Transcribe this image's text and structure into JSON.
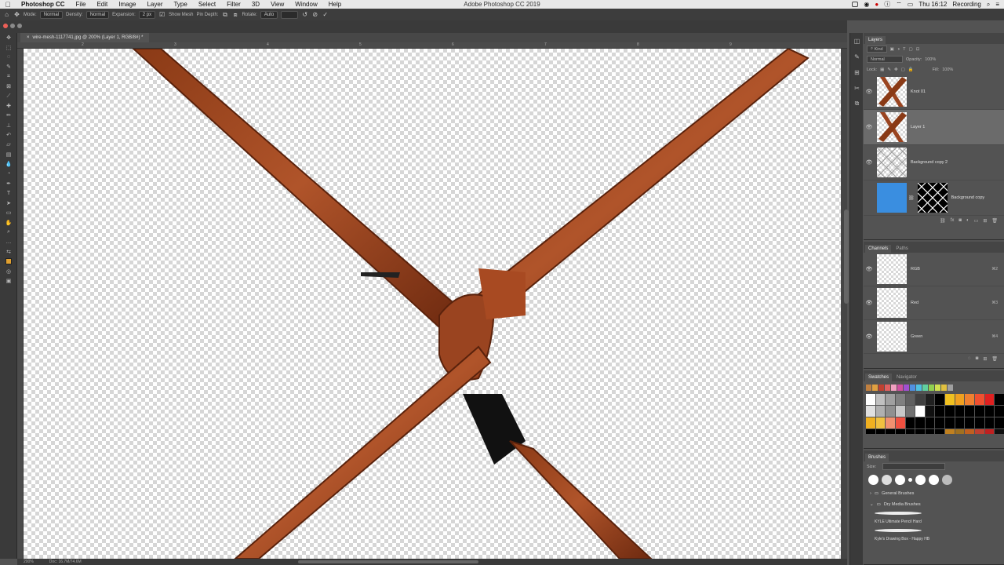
{
  "menubar": {
    "items": [
      "Photoshop CC",
      "File",
      "Edit",
      "Image",
      "Layer",
      "Type",
      "Select",
      "Filter",
      "3D",
      "View",
      "Window",
      "Help"
    ],
    "center_title": "Adobe Photoshop CC 2019",
    "clock": "Thu 16:12",
    "recording": "Recording"
  },
  "options": {
    "mode_label": "Mode:",
    "mode_value": "Normal",
    "density_label": "Density:",
    "density_value": "Normal",
    "expansion_label": "Expansion:",
    "expansion_value": "2 px",
    "show_mesh": "Show Mesh",
    "pin_depth": "Pin Depth:",
    "rotate_label": "Rotate:",
    "rotate_value": "Auto"
  },
  "document": {
    "tab_title": "wire-mesh-1117741.jpg @ 200% (Layer 1, RGB/8#) *"
  },
  "ruler": {
    "ticks": [
      "2",
      "3",
      "4",
      "5",
      "6",
      "7",
      "8",
      "9"
    ]
  },
  "status": {
    "zoom": "200%",
    "doc": "Doc: 16.7M/74.6M"
  },
  "layers_panel": {
    "tab": "Layers",
    "kind": "Kind",
    "blend": "Normal",
    "opacity_label": "Opacity:",
    "opacity": "100%",
    "lock_label": "Lock:",
    "fill_label": "Fill:",
    "fill": "100%",
    "layers": [
      {
        "name": "Knot 01"
      },
      {
        "name": "Layer 1"
      },
      {
        "name": "Background copy 2"
      },
      {
        "name": "Background copy"
      }
    ]
  },
  "channels_panel": {
    "tabs": [
      "Channels",
      "Paths"
    ],
    "channels": [
      {
        "name": "RGB",
        "shortcut": "⌘2"
      },
      {
        "name": "Red",
        "shortcut": "⌘3"
      },
      {
        "name": "Green",
        "shortcut": "⌘4"
      }
    ]
  },
  "swatches_panel": {
    "tabs": [
      "Swatches",
      "Navigator"
    ],
    "recent": [
      "#c08040",
      "#e0a040",
      "#c04030",
      "#e06060",
      "#f0a0c0",
      "#d050a0",
      "#a050d0",
      "#5090e0",
      "#50c0e0",
      "#60d0a0",
      "#90d050",
      "#d0e050",
      "#e0c040",
      "#a0a0a0"
    ],
    "row1": [
      "#ffffff",
      "#c0c0c0",
      "#a0a0a0",
      "#808080",
      "#606060",
      "#404040",
      "#202020",
      "#000000",
      "#f0c020",
      "#f0a020",
      "#f08030",
      "#f05030",
      "#e02020",
      "#000000"
    ],
    "row2": [
      "#e0e0e0",
      "#b0b0b0",
      "#909090",
      "#c8c8c8",
      "#707070",
      "#ffffff",
      "#101010",
      "#000000",
      "#000000",
      "#000000",
      "#000000",
      "#000000",
      "#000000",
      "#000000"
    ],
    "row3": [
      "#f0b020",
      "#f0c040",
      "#f09070",
      "#f05040",
      "#000000",
      "#000000",
      "#000000",
      "#000000",
      "#000000",
      "#000000",
      "#000000",
      "#000000",
      "#000000",
      "#000000"
    ],
    "row4": [
      "#000000",
      "#000000",
      "#000000",
      "#000000",
      "#000000",
      "#000000",
      "#000000",
      "#000000",
      "#c08020",
      "#a07020",
      "#c06020",
      "#c04030",
      "#c02020",
      "#101010"
    ]
  },
  "brushes_panel": {
    "tab": "Brushes",
    "size_label": "Size:",
    "folders": [
      "General Brushes",
      "Dry Media Brushes"
    ],
    "brushes": [
      "KYLE Ultimate Pencil Hard",
      "Kyle's Drawing Box - Happy HB"
    ]
  }
}
